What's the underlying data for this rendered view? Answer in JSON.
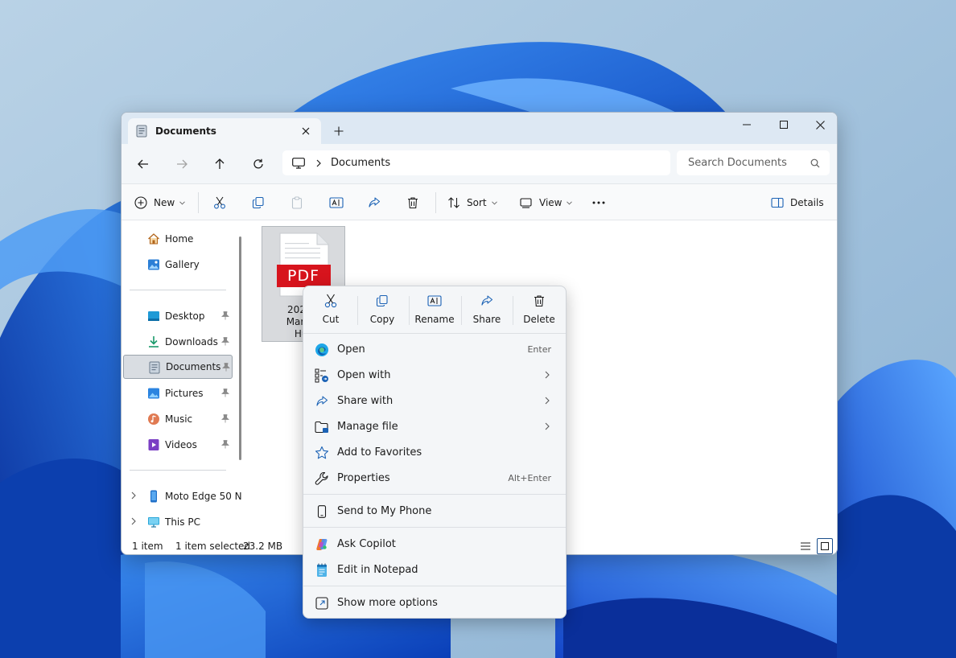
{
  "window": {
    "tab_title": "Documents",
    "address_path": "Documents",
    "search_placeholder": "Search Documents"
  },
  "toolbar": {
    "new_label": "New",
    "sort_label": "Sort",
    "view_label": "View",
    "details_label": "Details"
  },
  "sidebar": {
    "home": "Home",
    "gallery": "Gallery",
    "desktop": "Desktop",
    "downloads": "Downloads",
    "documents": "Documents",
    "pictures": "Pictures",
    "music": "Music",
    "videos": "Videos",
    "phone": "Moto Edge 50 N",
    "this_pc": "This PC"
  },
  "file": {
    "icon_badge": "PDF",
    "name_line1": "2025 S",
    "name_line2": "Marketi",
    "name_line3": "Hub"
  },
  "status": {
    "item_count": "1 item",
    "selection": "1 item selected",
    "size": "23.2 MB"
  },
  "context_menu": {
    "quick_actions": {
      "cut": "Cut",
      "copy": "Copy",
      "rename": "Rename",
      "share": "Share",
      "delete": "Delete"
    },
    "items": {
      "open": "Open",
      "open_accel": "Enter",
      "open_with": "Open with",
      "share_with": "Share with",
      "manage_file": "Manage file",
      "add_favorites": "Add to Favorites",
      "properties": "Properties",
      "properties_accel": "Alt+Enter",
      "send_phone": "Send to My Phone",
      "ask_copilot": "Ask Copilot",
      "edit_notepad": "Edit in Notepad",
      "show_more": "Show more options"
    }
  },
  "colors": {
    "accent": "#0067c0",
    "pdf_red": "#d7141d",
    "wallpaper_blue": "#1b63d8"
  }
}
